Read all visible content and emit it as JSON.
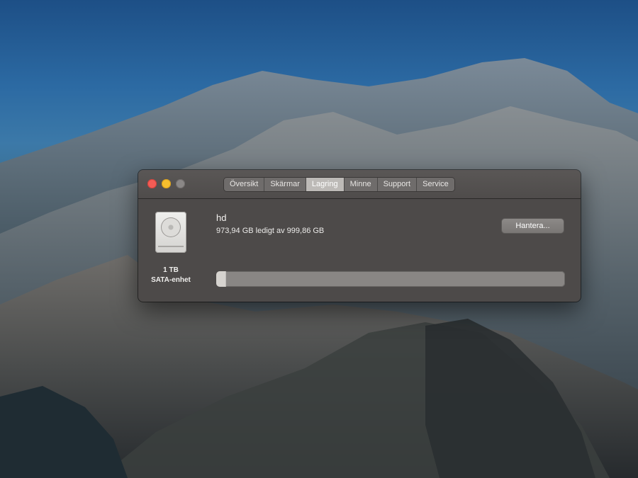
{
  "window": {
    "tabs": [
      {
        "label": "Översikt",
        "active": false
      },
      {
        "label": "Skärmar",
        "active": false
      },
      {
        "label": "Lagring",
        "active": true
      },
      {
        "label": "Minne",
        "active": false
      },
      {
        "label": "Support",
        "active": false
      },
      {
        "label": "Service",
        "active": false
      }
    ]
  },
  "drive": {
    "icon": "hard-drive-icon",
    "size_label": "1 TB",
    "type_label": "SATA-enhet"
  },
  "volume": {
    "name": "hd",
    "capacity_text": "973,94 GB ledigt av 999,86 GB",
    "used_fraction": 0.026
  },
  "actions": {
    "manage_label": "Hantera..."
  },
  "colors": {
    "close": "#f25c55",
    "minimize": "#f5be2e",
    "zoom": "#8a8786",
    "window_bg": "#4d4a49"
  }
}
